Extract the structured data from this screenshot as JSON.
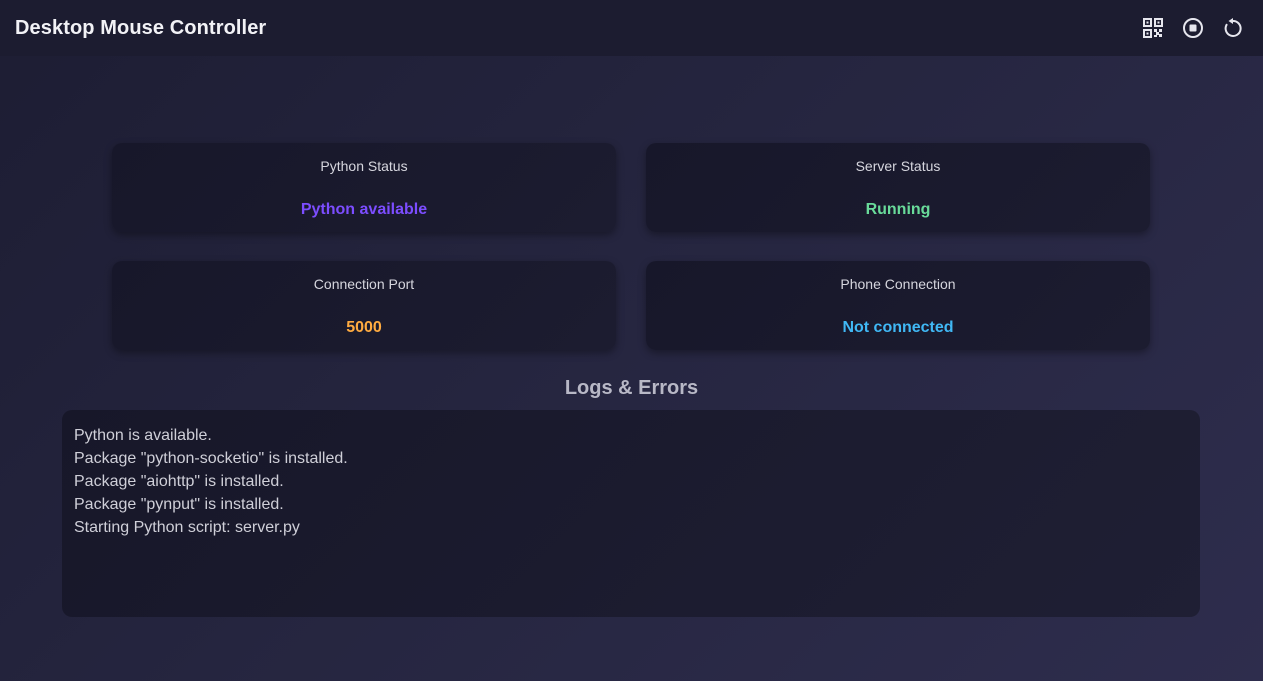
{
  "header": {
    "title": "Desktop Mouse Controller",
    "actions": [
      {
        "name": "qr-code-icon",
        "label": "QR code"
      },
      {
        "name": "stop-icon",
        "label": "Stop server"
      },
      {
        "name": "restart-icon",
        "label": "Restart"
      }
    ]
  },
  "status": {
    "python": {
      "label": "Python Status",
      "value": "Python available",
      "color": "#7c4dff"
    },
    "server": {
      "label": "Server Status",
      "value": "Running",
      "color": "#69db9a"
    },
    "port": {
      "label": "Connection Port",
      "value": "5000",
      "color": "#ffab40"
    },
    "phone": {
      "label": "Phone Connection",
      "value": "Not connected",
      "color": "#40b8f5"
    }
  },
  "logs": {
    "title": "Logs & Errors",
    "lines": [
      "Python is available.",
      "Package \"python-socketio\" is installed.",
      "Package \"aiohttp\" is installed.",
      "Package \"pynput\" is installed.",
      "Starting Python script: server.py"
    ]
  }
}
